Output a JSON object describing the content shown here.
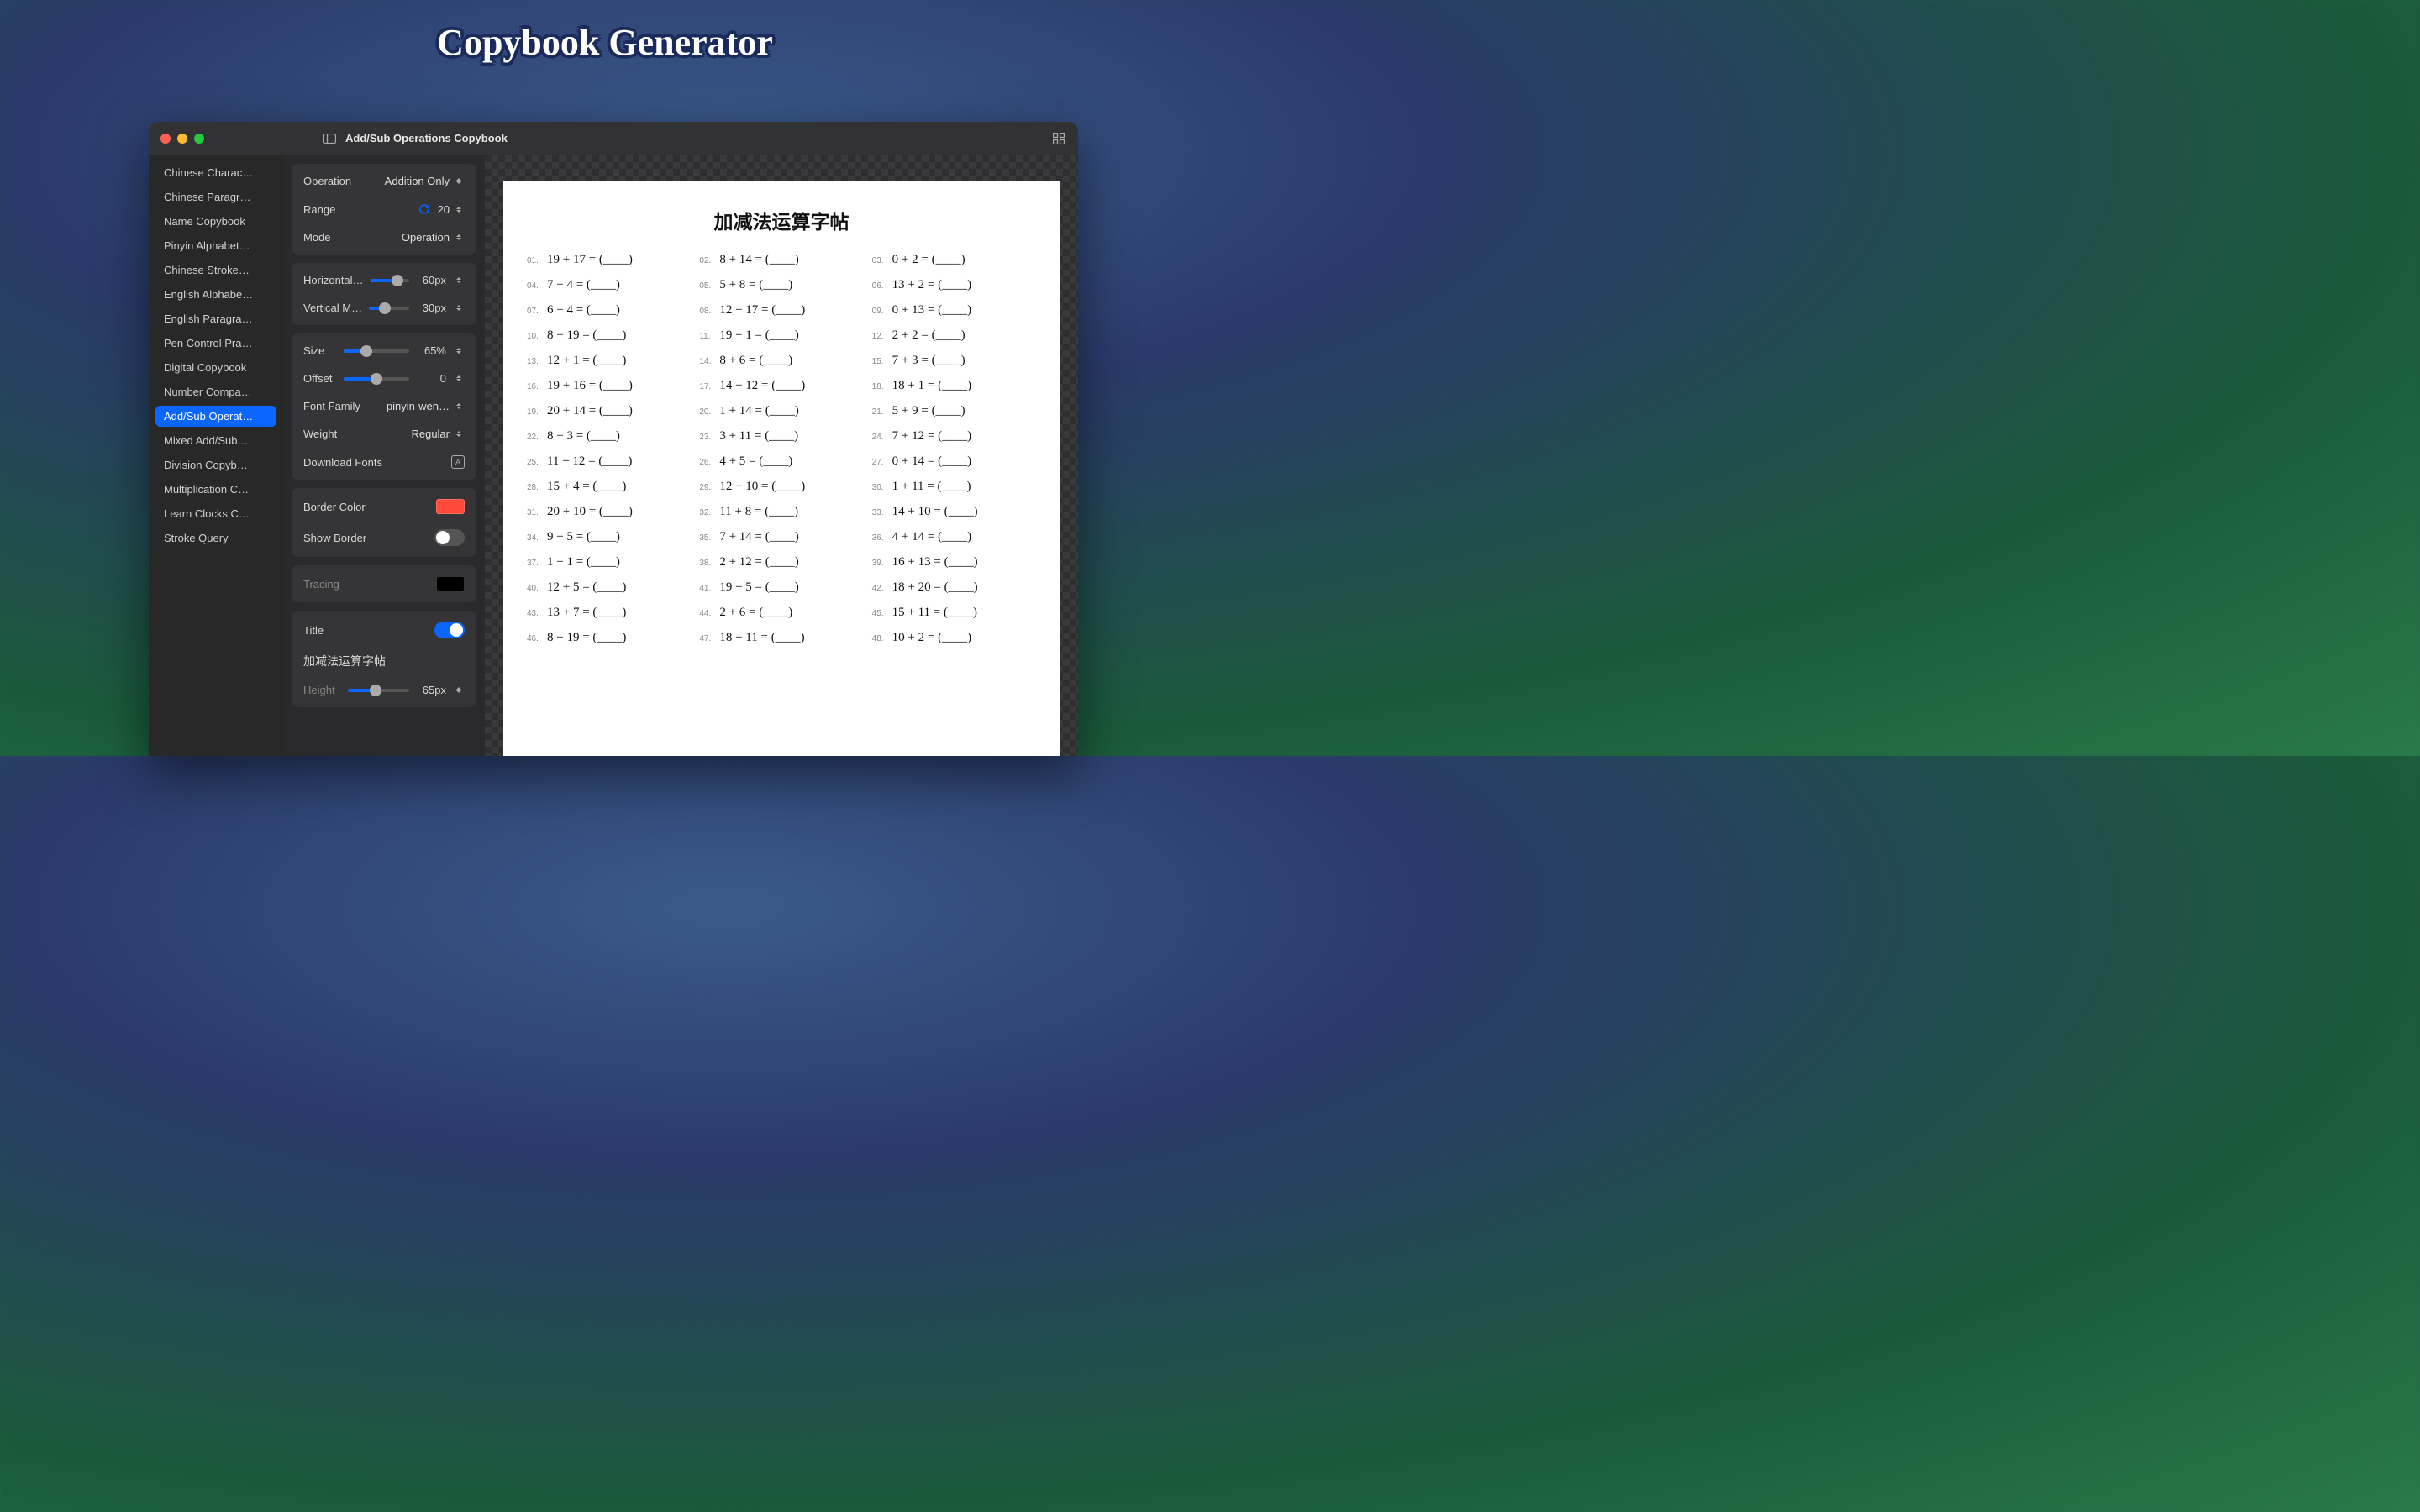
{
  "page_title": "Copybook Generator",
  "window": {
    "title": "Add/Sub Operations Copybook"
  },
  "sidebar": {
    "items": [
      "Chinese Charac…",
      "Chinese Paragr…",
      "Name Copybook",
      "Pinyin Alphabet…",
      "Chinese Stroke…",
      "English Alphabe…",
      "English Paragra…",
      "Pen Control Pra…",
      "Digital Copybook",
      "Number Compa…",
      "Add/Sub Operat…",
      "Mixed Add/Sub…",
      "Division Copyb…",
      "Multiplication C…",
      "Learn Clocks C…",
      "Stroke Query"
    ],
    "selected_index": 10
  },
  "settings": {
    "operation": {
      "label": "Operation",
      "value": "Addition Only"
    },
    "range": {
      "label": "Range",
      "value": "20"
    },
    "mode": {
      "label": "Mode",
      "value": "Operation"
    },
    "horizontal": {
      "label": "Horizontal…",
      "value": "60px",
      "pct": 70
    },
    "vertical": {
      "label": "Vertical M…",
      "value": "30px",
      "pct": 40
    },
    "size": {
      "label": "Size",
      "value": "65%",
      "pct": 35
    },
    "offset": {
      "label": "Offset",
      "value": "0",
      "pct": 50
    },
    "font_family": {
      "label": "Font Family",
      "value": "pinyin-wen…"
    },
    "weight": {
      "label": "Weight",
      "value": "Regular"
    },
    "download_fonts": "Download Fonts",
    "border_color": {
      "label": "Border Color",
      "value": "#ff4a3a"
    },
    "show_border": {
      "label": "Show Border",
      "on": false
    },
    "tracing": {
      "label": "Tracing",
      "value": "#000000"
    },
    "title": {
      "label": "Title",
      "on": true
    },
    "title_text": "加减法运算字帖",
    "height": {
      "label": "Height",
      "value": "65px",
      "pct": 45
    }
  },
  "preview": {
    "title": "加减法运算字帖",
    "problems": [
      {
        "n": "01.",
        "eq": "19 + 17 = (____)"
      },
      {
        "n": "02.",
        "eq": "8 + 14 = (____)"
      },
      {
        "n": "03.",
        "eq": "0 + 2 = (____)"
      },
      {
        "n": "04.",
        "eq": "7 + 4 = (____)"
      },
      {
        "n": "05.",
        "eq": "5 + 8 = (____)"
      },
      {
        "n": "06.",
        "eq": "13 + 2 = (____)"
      },
      {
        "n": "07.",
        "eq": "6 + 4 = (____)"
      },
      {
        "n": "08.",
        "eq": "12 + 17 = (____)"
      },
      {
        "n": "09.",
        "eq": "0 + 13 = (____)"
      },
      {
        "n": "10.",
        "eq": "8 + 19 = (____)"
      },
      {
        "n": "11.",
        "eq": "19 + 1 = (____)"
      },
      {
        "n": "12.",
        "eq": "2 + 2 = (____)"
      },
      {
        "n": "13.",
        "eq": "12 + 1 = (____)"
      },
      {
        "n": "14.",
        "eq": "8 + 6 = (____)"
      },
      {
        "n": "15.",
        "eq": "7 + 3 = (____)"
      },
      {
        "n": "16.",
        "eq": "19 + 16 = (____)"
      },
      {
        "n": "17.",
        "eq": "14 + 12 = (____)"
      },
      {
        "n": "18.",
        "eq": "18 + 1 = (____)"
      },
      {
        "n": "19.",
        "eq": "20 + 14 = (____)"
      },
      {
        "n": "20.",
        "eq": "1 + 14 = (____)"
      },
      {
        "n": "21.",
        "eq": "5 + 9 = (____)"
      },
      {
        "n": "22.",
        "eq": "8 + 3 = (____)"
      },
      {
        "n": "23.",
        "eq": "3 + 11 = (____)"
      },
      {
        "n": "24.",
        "eq": "7 + 12 = (____)"
      },
      {
        "n": "25.",
        "eq": "11 + 12 = (____)"
      },
      {
        "n": "26.",
        "eq": "4 + 5 = (____)"
      },
      {
        "n": "27.",
        "eq": "0 + 14 = (____)"
      },
      {
        "n": "28.",
        "eq": "15 + 4 = (____)"
      },
      {
        "n": "29.",
        "eq": "12 + 10 = (____)"
      },
      {
        "n": "30.",
        "eq": "1 + 11 = (____)"
      },
      {
        "n": "31.",
        "eq": "20 + 10 = (____)"
      },
      {
        "n": "32.",
        "eq": "11 + 8 = (____)"
      },
      {
        "n": "33.",
        "eq": "14 + 10 = (____)"
      },
      {
        "n": "34.",
        "eq": "9 + 5 = (____)"
      },
      {
        "n": "35.",
        "eq": "7 + 14 = (____)"
      },
      {
        "n": "36.",
        "eq": "4 + 14 = (____)"
      },
      {
        "n": "37.",
        "eq": "1 + 1 = (____)"
      },
      {
        "n": "38.",
        "eq": "2 + 12 = (____)"
      },
      {
        "n": "39.",
        "eq": "16 + 13 = (____)"
      },
      {
        "n": "40.",
        "eq": "12 + 5 = (____)"
      },
      {
        "n": "41.",
        "eq": "19 + 5 = (____)"
      },
      {
        "n": "42.",
        "eq": "18 + 20 = (____)"
      },
      {
        "n": "43.",
        "eq": "13 + 7 = (____)"
      },
      {
        "n": "44.",
        "eq": "2 + 6 = (____)"
      },
      {
        "n": "45.",
        "eq": "15 + 11 = (____)"
      },
      {
        "n": "46.",
        "eq": "8 + 19 = (____)"
      },
      {
        "n": "47.",
        "eq": "18 + 11 = (____)"
      },
      {
        "n": "48.",
        "eq": "10 + 2 = (____)"
      }
    ]
  }
}
